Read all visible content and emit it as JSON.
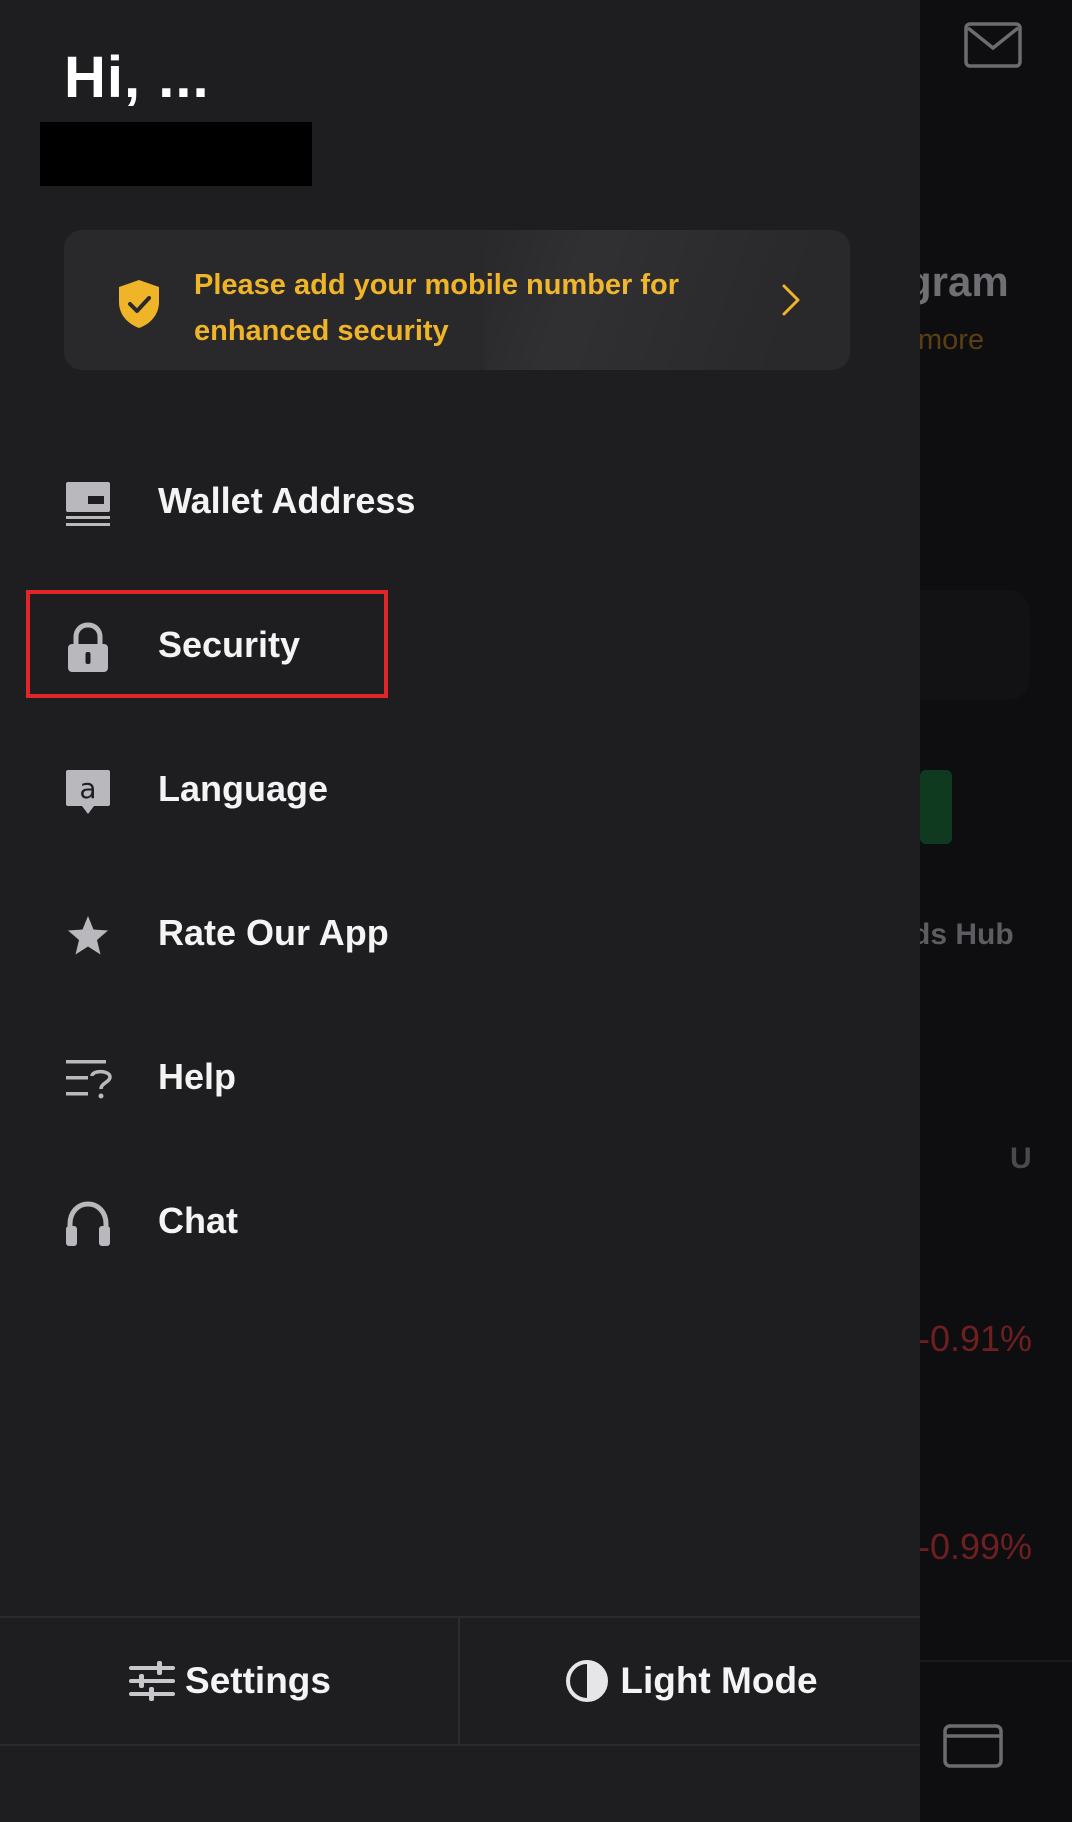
{
  "background": {
    "title_fragment": "gram",
    "more_fragment": "more",
    "hub_fragment": "ds Hub",
    "column_fragment": "U",
    "change_1": "-0.91%",
    "change_2": "-0.99%",
    "icons": {
      "mail": "mail-icon",
      "wallet": "wallet-icon"
    }
  },
  "drawer": {
    "greeting": "Hi, ...",
    "promo": {
      "text": "Please add your mobile number for enhanced security",
      "icon": "shield-check-icon",
      "accent_color": "#f0b429"
    },
    "menu": [
      {
        "label": "Wallet Address",
        "icon": "wallet-address-icon"
      },
      {
        "label": "Security",
        "icon": "lock-icon",
        "highlighted": true
      },
      {
        "label": "Language",
        "icon": "language-icon"
      },
      {
        "label": "Rate Our App",
        "icon": "star-icon"
      },
      {
        "label": "Help",
        "icon": "help-icon"
      },
      {
        "label": "Chat",
        "icon": "headset-icon"
      }
    ],
    "footer": {
      "settings_label": "Settings",
      "light_mode_label": "Light Mode"
    }
  },
  "colors": {
    "drawer_bg": "#1e1e20",
    "highlight_border": "#e0262a",
    "negative_change": "#6e1f22"
  }
}
